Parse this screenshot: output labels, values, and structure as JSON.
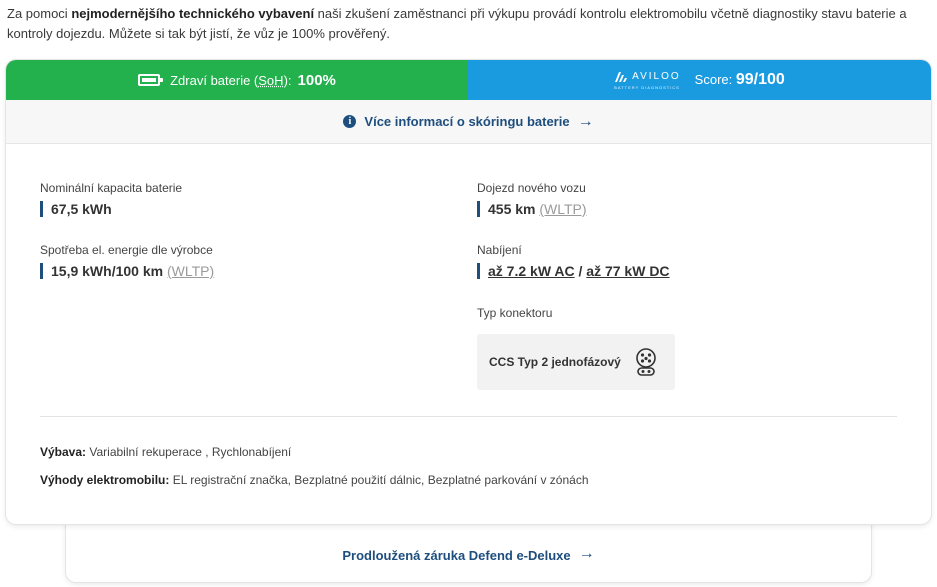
{
  "intro": {
    "part1": "Za pomoci ",
    "bold": "nejmodernějšího technického vybavení",
    "part2": " naši zkušení zaměstnanci při výkupu provádí kontrolu elektromobilu včetně diagnostiky stavu baterie a kontroly dojezdu. Můžete si tak být jistí, že vůz je 100% prověřený."
  },
  "banner": {
    "soh_label": "Zdraví baterie (",
    "soh_abbr": "SoH",
    "soh_label_end": "):",
    "soh_value": "100%",
    "aviloo_brand": "AVILOO",
    "aviloo_sub": "BATTERY DIAGNOSTICS",
    "score_label": "Score:",
    "score_value": "99/100",
    "colors": {
      "soh_bg": "#22b14c",
      "aviloo_bg": "#1a9be0"
    }
  },
  "info_link": {
    "label": "Více informací o skóringu baterie",
    "icon": "info-icon"
  },
  "specs": {
    "capacity": {
      "label": "Nominální kapacita baterie",
      "value": "67,5 kWh"
    },
    "range": {
      "label": "Dojezd nového vozu",
      "value": "455 km",
      "unit_note": "(WLTP)"
    },
    "consumption": {
      "label": "Spotřeba el. energie dle výrobce",
      "value": "15,9 kWh/100 km",
      "unit_note": "(WLTP)"
    },
    "charging": {
      "label": "Nabíjení",
      "ac": "až 7.2 kW AC",
      "sep": " / ",
      "dc": "až 77 kW DC"
    },
    "connector": {
      "label": "Typ konektoru",
      "value": "CCS Typ 2 jednofázový",
      "icon": "ccs-connector-icon"
    }
  },
  "equipment": {
    "label": "Výbava:",
    "value": " Variabilní rekuperace , Rychlonabíjení"
  },
  "benefits": {
    "label": "Výhody elektromobilu:",
    "value": " EL registrační značka, Bezplatné použití dálnic, Bezplatné parkování v zónách"
  },
  "warranty": {
    "label": "Prodloužená záruka Defend e-Deluxe"
  },
  "accent_color": "#1d4e7e"
}
